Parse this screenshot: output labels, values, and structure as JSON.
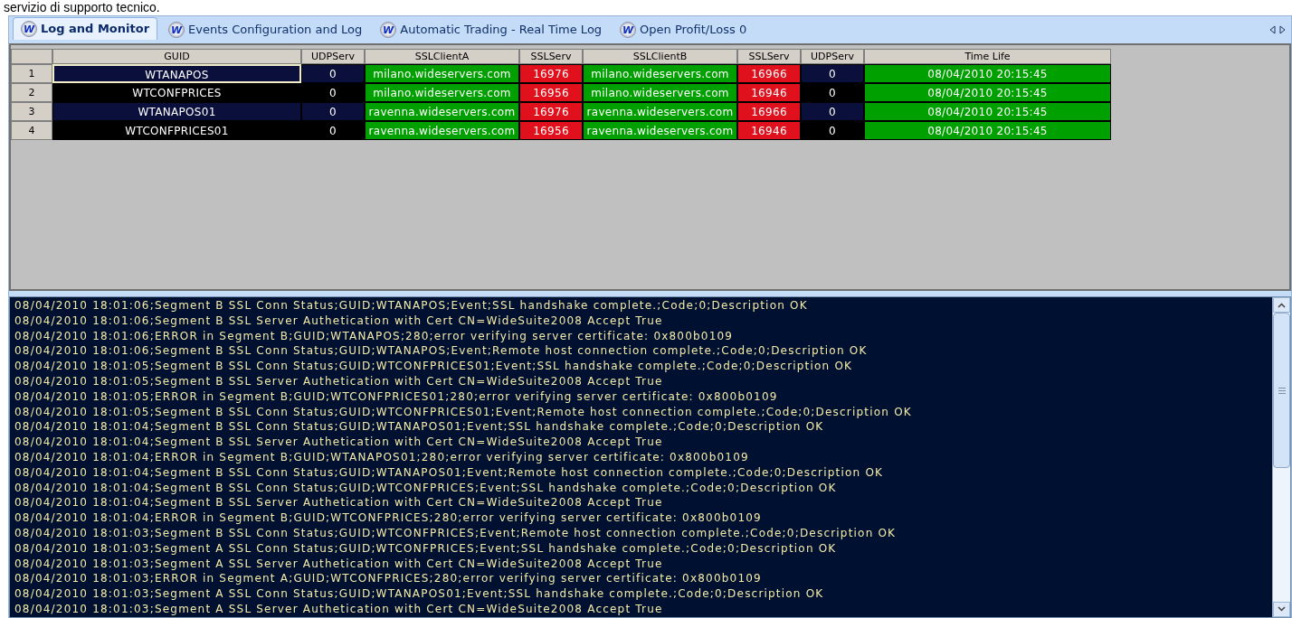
{
  "caption": "servizio di supporto tecnico.",
  "tabs": [
    {
      "logo": "W",
      "label": "Log and Monitor",
      "selected": true
    },
    {
      "logo": "W",
      "label": "Events Configuration and Log",
      "selected": false
    },
    {
      "logo": "W",
      "label": "Automatic Trading - Real Time Log",
      "selected": false
    },
    {
      "logo": "W",
      "label": "Open Profit/Loss 0",
      "selected": false
    }
  ],
  "table": {
    "columns": [
      {
        "label": "GUID",
        "kind": "name"
      },
      {
        "label": "UDPServ",
        "kind": "plain"
      },
      {
        "label": "SSLClientA",
        "kind": "host"
      },
      {
        "label": "SSLServ",
        "kind": "port"
      },
      {
        "label": "SSLClientB",
        "kind": "host"
      },
      {
        "label": "SSLServ",
        "kind": "port"
      },
      {
        "label": "UDPServ",
        "kind": "plain"
      },
      {
        "label": "Time Life",
        "kind": "time"
      }
    ],
    "rows": [
      {
        "number": "1",
        "selected": true,
        "cells": [
          "WTANAPOS",
          "0",
          "milano.wideservers.com",
          "16976",
          "milano.wideservers.com",
          "16966",
          "0",
          "08/04/2010 20:15:45"
        ]
      },
      {
        "number": "2",
        "selected": false,
        "cells": [
          "WTCONFPRICES",
          "0",
          "milano.wideservers.com",
          "16956",
          "milano.wideservers.com",
          "16946",
          "0",
          "08/04/2010 20:15:45"
        ]
      },
      {
        "number": "3",
        "selected": false,
        "cells": [
          "WTANAPOS01",
          "0",
          "ravenna.wideservers.com",
          "16976",
          "ravenna.wideservers.com",
          "16966",
          "0",
          "08/04/2010 20:15:45"
        ]
      },
      {
        "number": "4",
        "selected": false,
        "cells": [
          "WTCONFPRICES01",
          "0",
          "ravenna.wideservers.com",
          "16956",
          "ravenna.wideservers.com",
          "16946",
          "0",
          "08/04/2010 20:15:45"
        ]
      }
    ]
  },
  "log": [
    "08/04/2010 18:01:06;Segment B SSL Conn Status;GUID;WTANAPOS;Event;SSL handshake complete.;Code;0;Description OK",
    "08/04/2010 18:01:06;Segment B SSL Server Authetication with Cert CN=WideSuite2008 Accept True",
    "08/04/2010 18:01:06;ERROR in Segment B;GUID;WTANAPOS;280;error verifying server certificate: 0x800b0109",
    "08/04/2010 18:01:06;Segment B SSL Conn Status;GUID;WTANAPOS;Event;Remote host connection complete.;Code;0;Description OK",
    "08/04/2010 18:01:05;Segment B SSL Conn Status;GUID;WTCONFPRICES01;Event;SSL handshake complete.;Code;0;Description OK",
    "08/04/2010 18:01:05;Segment B SSL Server Authetication with Cert CN=WideSuite2008 Accept True",
    "08/04/2010 18:01:05;ERROR in Segment B;GUID;WTCONFPRICES01;280;error verifying server certificate: 0x800b0109",
    "08/04/2010 18:01:05;Segment B SSL Conn Status;GUID;WTCONFPRICES01;Event;Remote host connection complete.;Code;0;Description OK",
    "08/04/2010 18:01:04;Segment B SSL Conn Status;GUID;WTANAPOS01;Event;SSL handshake complete.;Code;0;Description OK",
    "08/04/2010 18:01:04;Segment B SSL Server Authetication with Cert CN=WideSuite2008 Accept True",
    "08/04/2010 18:01:04;ERROR in Segment B;GUID;WTANAPOS01;280;error verifying server certificate: 0x800b0109",
    "08/04/2010 18:01:04;Segment B SSL Conn Status;GUID;WTANAPOS01;Event;Remote host connection complete.;Code;0;Description OK",
    "08/04/2010 18:01:04;Segment B SSL Conn Status;GUID;WTCONFPRICES;Event;SSL handshake complete.;Code;0;Description OK",
    "08/04/2010 18:01:04;Segment B SSL Server Authetication with Cert CN=WideSuite2008 Accept True",
    "08/04/2010 18:01:04;ERROR in Segment B;GUID;WTCONFPRICES;280;error verifying server certificate: 0x800b0109",
    "08/04/2010 18:01:03;Segment B SSL Conn Status;GUID;WTCONFPRICES;Event;Remote host connection complete.;Code;0;Description OK",
    "08/04/2010 18:01:03;Segment A SSL Conn Status;GUID;WTCONFPRICES;Event;SSL handshake complete.;Code;0;Description OK",
    "08/04/2010 18:01:03;Segment A SSL Server Authetication with Cert CN=WideSuite2008 Accept True",
    "08/04/2010 18:01:03;ERROR in Segment A;GUID;WTCONFPRICES;280;error verifying server certificate: 0x800b0109",
    "08/04/2010 18:01:03;Segment A SSL Conn Status;GUID;WTANAPOS01;Event;SSL handshake complete.;Code;0;Description OK",
    "08/04/2010 18:01:03;Segment A SSL Server Authetication with Cert CN=WideSuite2008 Accept True"
  ]
}
